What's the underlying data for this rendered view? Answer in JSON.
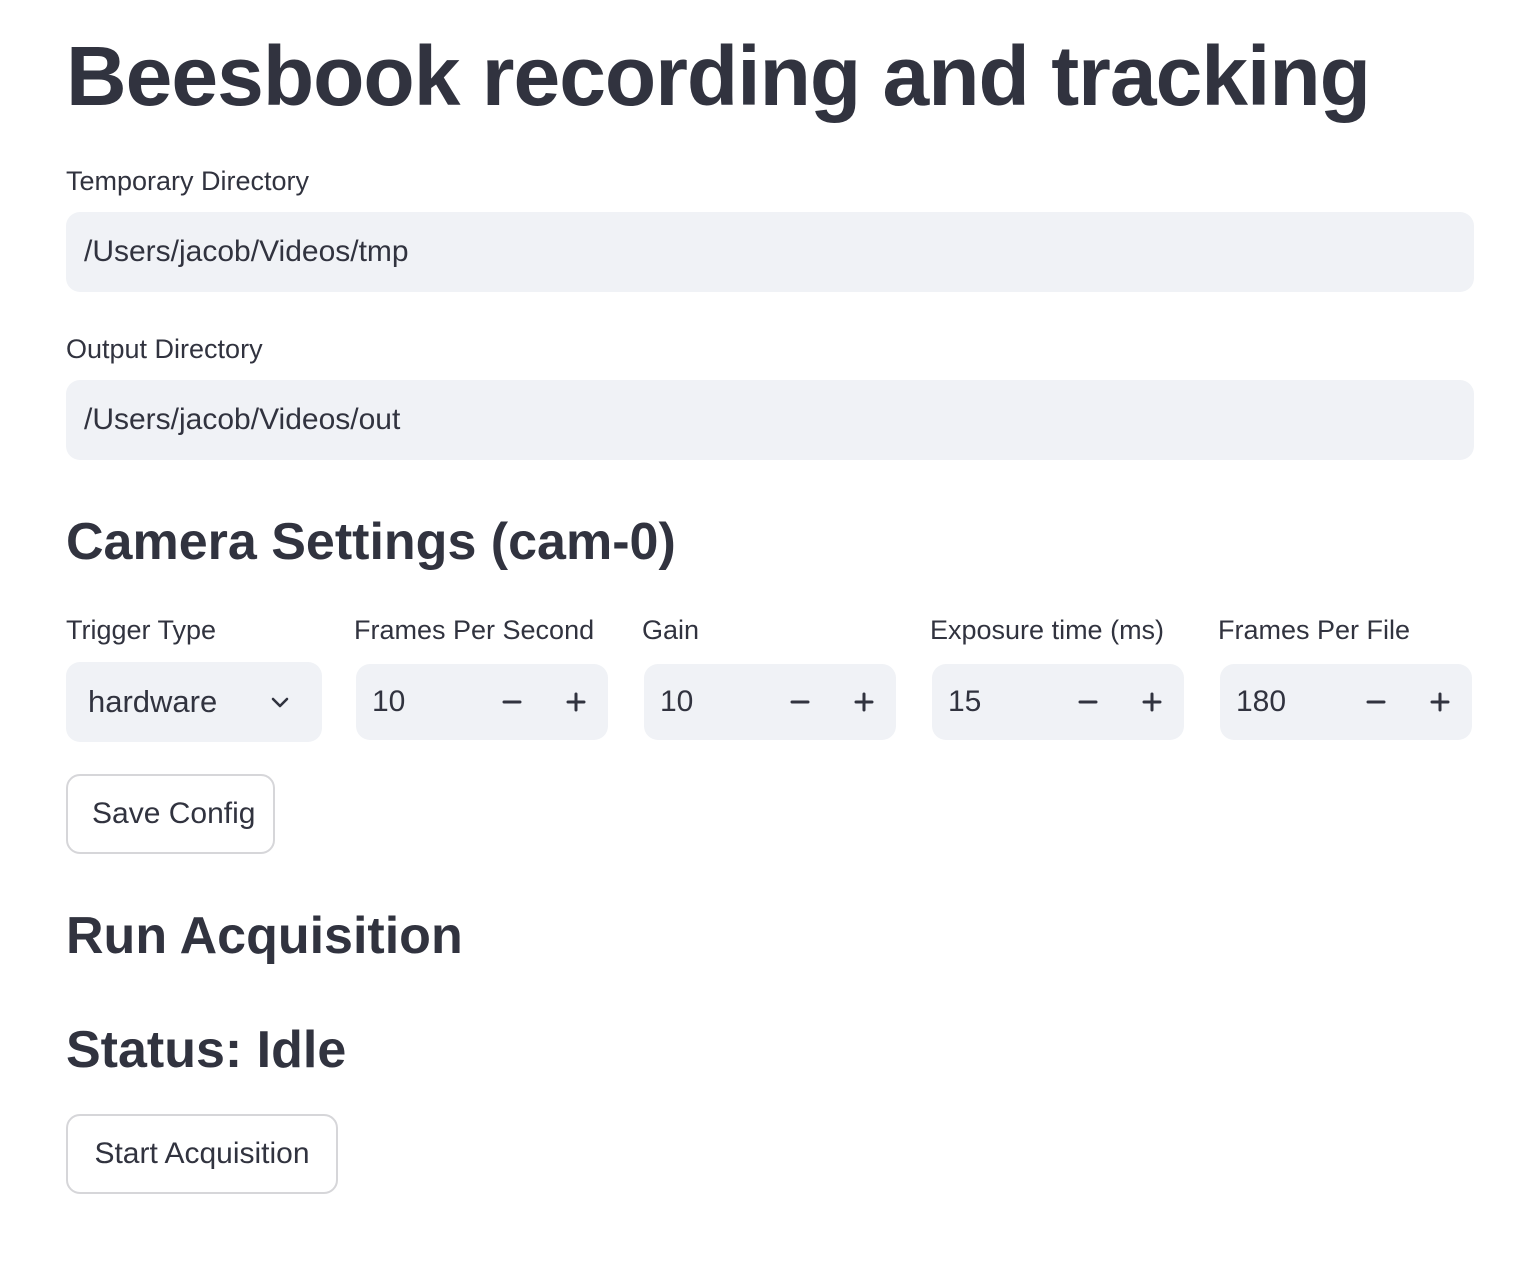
{
  "app": {
    "title": "Beesbook recording and tracking"
  },
  "directories": {
    "temporary": {
      "label": "Temporary Directory",
      "value": "/Users/jacob/Videos/tmp"
    },
    "output": {
      "label": "Output Directory",
      "value": "/Users/jacob/Videos/out"
    }
  },
  "camera_settings": {
    "heading": "Camera Settings (cam-0)",
    "trigger_type": {
      "label": "Trigger Type",
      "selected": "hardware",
      "icon": "chevron-down-icon"
    },
    "frames_per_second": {
      "label": "Frames Per Second",
      "value": "10"
    },
    "gain": {
      "label": "Gain",
      "value": "10"
    },
    "exposure_time": {
      "label": "Exposure time (ms)",
      "value": "15"
    },
    "frames_per_file": {
      "label": "Frames Per File",
      "value": "180"
    },
    "save_button_label": "Save Config"
  },
  "acquisition": {
    "heading": "Run Acquisition",
    "status_text": "Status: Idle",
    "start_button_label": "Start Acquisition"
  },
  "colors": {
    "text": "#31333f",
    "input_background": "#f0f2f6",
    "button_border": "#d6d6d9",
    "background": "#ffffff"
  }
}
